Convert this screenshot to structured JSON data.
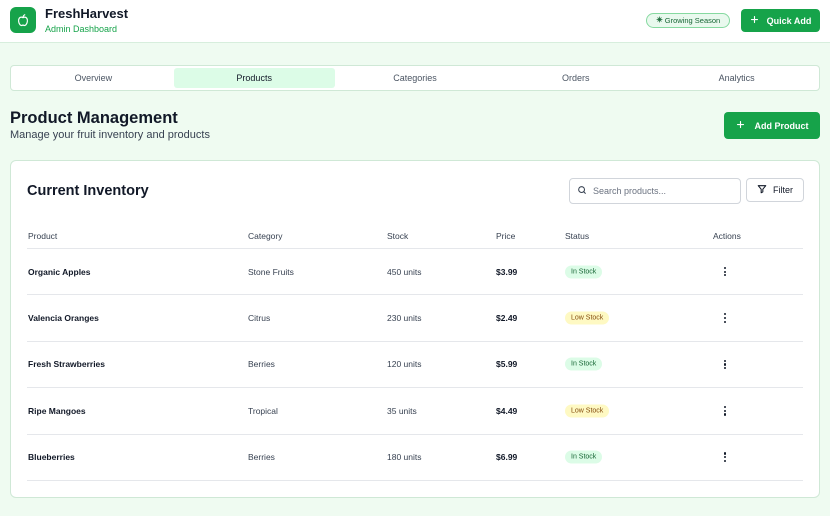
{
  "app": {
    "name": "FreshHarvest",
    "subtitle": "Admin Dashboard",
    "season_badge": "Growing Season",
    "quick_add": "Quick Add"
  },
  "tabs": [
    {
      "label": "Overview"
    },
    {
      "label": "Products",
      "active": true
    },
    {
      "label": "Categories"
    },
    {
      "label": "Orders"
    },
    {
      "label": "Analytics"
    }
  ],
  "page": {
    "title": "Product Management",
    "subtitle": "Manage your fruit inventory and products",
    "add_button": "Add Product"
  },
  "inventory": {
    "title": "Current Inventory",
    "search_placeholder": "Search products...",
    "filter_label": "Filter",
    "columns": [
      "Product",
      "Category",
      "Stock",
      "Price",
      "Status",
      "Actions"
    ],
    "rows": [
      {
        "product": "Organic Apples",
        "category": "Stone Fruits",
        "stock": "450 units",
        "price": "$3.99",
        "status": "In Stock"
      },
      {
        "product": "Valencia Oranges",
        "category": "Citrus",
        "stock": "230 units",
        "price": "$2.49",
        "status": "Low Stock"
      },
      {
        "product": "Fresh Strawberries",
        "category": "Berries",
        "stock": "120 units",
        "price": "$5.99",
        "status": "In Stock"
      },
      {
        "product": "Ripe Mangoes",
        "category": "Tropical",
        "stock": "35 units",
        "price": "$4.49",
        "status": "Low Stock"
      },
      {
        "product": "Blueberries",
        "category": "Berries",
        "stock": "180 units",
        "price": "$6.99",
        "status": "In Stock"
      }
    ]
  },
  "colors": {
    "accent": "#16a34a",
    "background": "#effbf1",
    "in_stock_bg": "#dcfce7",
    "low_stock_bg": "#fef9c3"
  },
  "icons": {
    "logo": "apple-icon",
    "season": "sprout-icon",
    "quick_add": "plus-icon",
    "search": "search-icon",
    "filter": "filter-icon",
    "actions": "more-vertical-icon"
  }
}
